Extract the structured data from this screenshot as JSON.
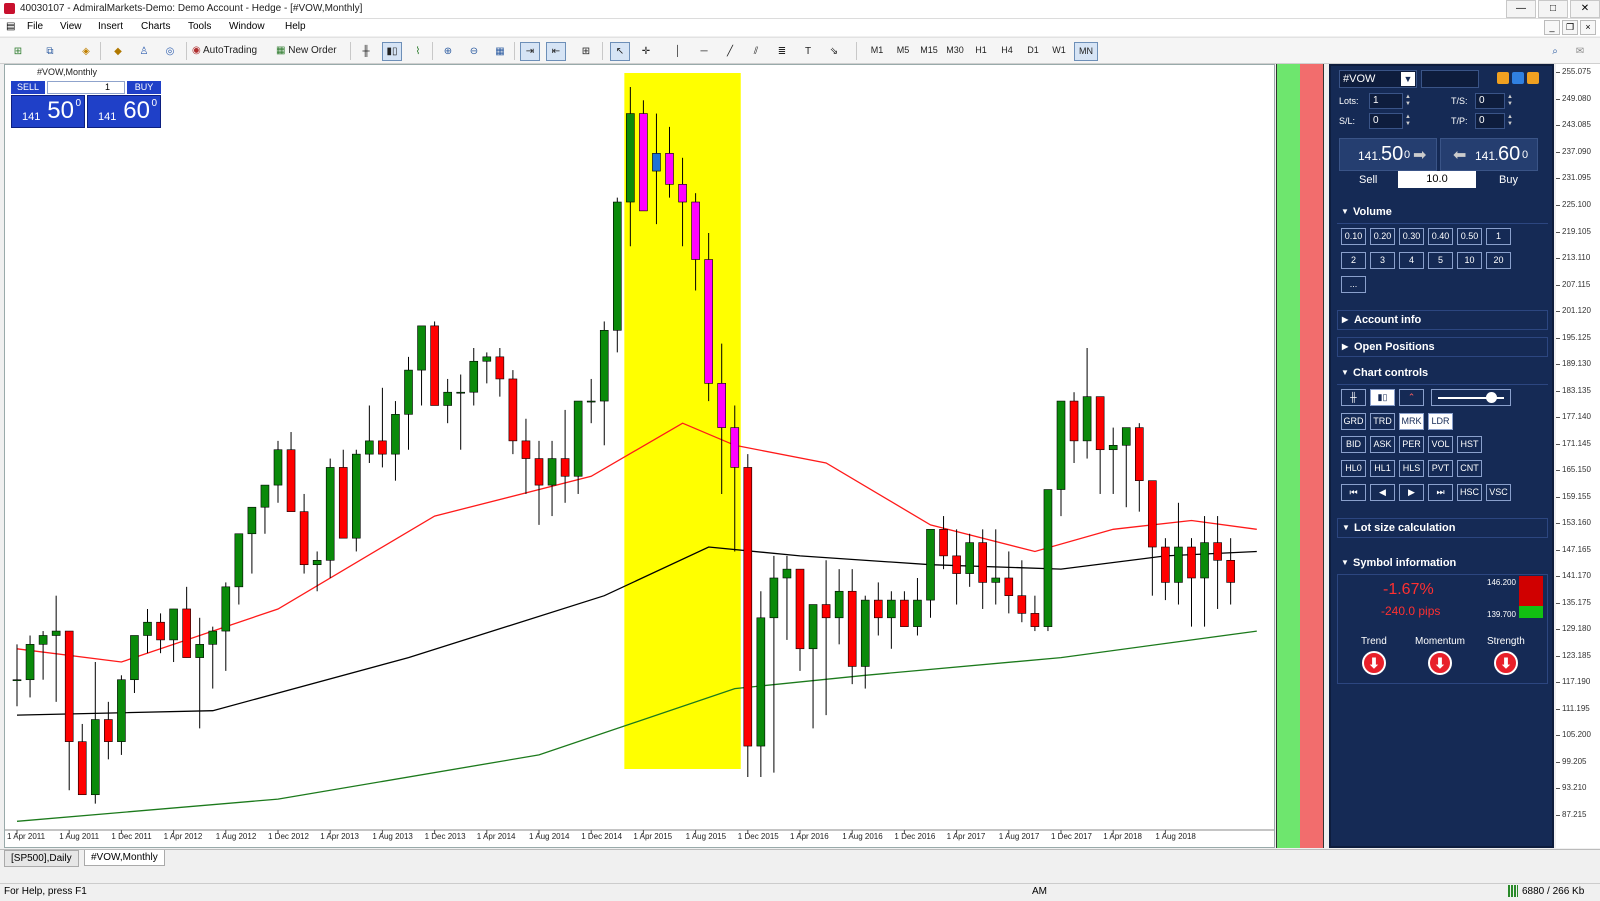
{
  "window": {
    "title": "40030107 - AdmiralMarkets-Demo: Demo Account - Hedge - [#VOW,Monthly]",
    "buttons": [
      "—",
      "□",
      "✕"
    ]
  },
  "menu": [
    "File",
    "View",
    "Insert",
    "Charts",
    "Tools",
    "Window",
    "Help"
  ],
  "mdi_buttons": [
    "_",
    "❐",
    "×"
  ],
  "toolbar": {
    "autotrading": "AutoTrading",
    "new_order": "New Order",
    "timeframes": [
      "M1",
      "M5",
      "M15",
      "M30",
      "H1",
      "H4",
      "D1",
      "W1",
      "MN"
    ],
    "active_timeframe": "MN"
  },
  "chart_title": "#VOW,Monthly",
  "one_click": {
    "sell_label": "SELL",
    "buy_label": "BUY",
    "lot": "1",
    "sell_small": "141",
    "sell_big": "50",
    "sell_sup": "0",
    "buy_small": "141",
    "buy_big": "60",
    "buy_sup": "0"
  },
  "panel": {
    "symbol": "#VOW",
    "lots_label": "Lots:",
    "lots_value": "1",
    "ts_label": "T/S:",
    "ts_value": "0",
    "sl_label": "S/L:",
    "sl_value": "0",
    "tp_label": "T/P:",
    "tp_value": "0",
    "sell_price_small": "141.",
    "sell_price_big": "50",
    "sell_price_sup": "0",
    "buy_price_small": "141.",
    "buy_price_big": "60",
    "buy_price_sup": "0",
    "sell_label": "Sell",
    "buy_label": "Buy",
    "spread": "10.0",
    "sections": {
      "volume": "Volume",
      "account": "Account info",
      "positions": "Open Positions",
      "controls": "Chart controls",
      "lotsize": "Lot size calculation",
      "symbol_info": "Symbol information"
    },
    "volumes": [
      "0.10",
      "0.20",
      "0.30",
      "0.40",
      "0.50",
      "1",
      "2",
      "3",
      "4",
      "5",
      "10",
      "20",
      "..."
    ],
    "control_row1": [
      "GRD",
      "TRD",
      "MRK",
      "LDR"
    ],
    "control_row2": [
      "BID",
      "ASK",
      "PER",
      "VOL",
      "HST"
    ],
    "control_row3": [
      "HL0",
      "HL1",
      "HLS",
      "PVT",
      "CNT"
    ],
    "control_row4": [
      "⏮",
      "◀",
      "▶",
      "⏭",
      "HSC",
      "VSC"
    ],
    "change_pct": "-1.67%",
    "change_pips": "-240.0 pips",
    "range_high": "146.200",
    "range_low": "139.700",
    "trend_label": "Trend",
    "momentum_label": "Momentum",
    "strength_label": "Strength"
  },
  "tabs": [
    "[SP500],Daily",
    "#VOW,Monthly"
  ],
  "active_tab": "#VOW,Monthly",
  "status": {
    "help": "For Help, press F1",
    "mode": "AM",
    "traffic": "6880 / 266 Kb"
  },
  "colors": {
    "bull": "#0a8a0a",
    "bear": "#ff0000",
    "fall_highlight": "#ff00ff",
    "blue_candle": "#1e73d6",
    "highlight_zone": "#ffff00",
    "ma_fast": "#ff1a1a",
    "ma_mid": "#000000",
    "ma_slow": "#1c7a1c",
    "panel_bg": "#152a55"
  },
  "chart_data": {
    "type": "candlestick",
    "symbol": "#VOW",
    "timeframe": "Monthly",
    "ylim": [
      84.25,
      256.075
    ],
    "y_ticks": [
      "255.075",
      "249.080",
      "243.085",
      "237.090",
      "231.095",
      "225.100",
      "219.105",
      "213.110",
      "207.115",
      "201.120",
      "195.125",
      "189.130",
      "183.135",
      "177.140",
      "171.145",
      "165.150",
      "159.155",
      "153.160",
      "147.165",
      "141.170",
      "135.175",
      "129.180",
      "123.185",
      "117.190",
      "111.195",
      "105.200",
      "99.205",
      "93.210",
      "87.215"
    ],
    "x_labels": [
      "1 Apr 2011",
      "1 Aug 2011",
      "1 Dec 2011",
      "1 Apr 2012",
      "1 Aug 2012",
      "1 Dec 2012",
      "1 Apr 2013",
      "1 Aug 2013",
      "1 Dec 2013",
      "1 Apr 2014",
      "1 Aug 2014",
      "1 Dec 2014",
      "1 Apr 2015",
      "1 Aug 2015",
      "1 Dec 2015",
      "1 Apr 2016",
      "1 Aug 2016",
      "1 Dec 2016",
      "1 Apr 2017",
      "1 Aug 2017",
      "1 Dec 2017",
      "1 Apr 2018",
      "1 Aug 2018"
    ],
    "first_bar": "2011-04",
    "ohlc": [
      [
        118,
        126,
        112,
        118
      ],
      [
        118,
        128,
        114,
        126
      ],
      [
        126,
        129,
        118,
        128
      ],
      [
        128,
        137,
        113,
        129
      ],
      [
        129,
        129,
        93,
        104
      ],
      [
        104,
        108,
        92,
        92
      ],
      [
        92,
        122,
        90,
        109
      ],
      [
        109,
        113,
        100,
        104
      ],
      [
        104,
        119,
        101,
        118
      ],
      [
        118,
        128,
        115,
        128
      ],
      [
        128,
        134,
        124,
        131
      ],
      [
        131,
        133,
        124,
        127
      ],
      [
        127,
        134,
        122,
        134
      ],
      [
        134,
        139,
        123,
        123
      ],
      [
        123,
        132,
        107,
        126
      ],
      [
        126,
        130,
        116,
        129
      ],
      [
        129,
        140,
        120,
        139
      ],
      [
        139,
        151,
        135,
        151
      ],
      [
        151,
        157,
        142,
        157
      ],
      [
        157,
        162,
        151,
        162
      ],
      [
        162,
        172,
        158,
        170
      ],
      [
        170,
        174,
        160,
        156
      ],
      [
        156,
        160,
        142,
        144
      ],
      [
        144,
        147,
        138,
        145
      ],
      [
        145,
        168,
        141,
        166
      ],
      [
        166,
        170,
        155,
        150
      ],
      [
        150,
        170,
        147,
        169
      ],
      [
        169,
        180,
        167,
        172
      ],
      [
        172,
        184,
        166,
        169
      ],
      [
        169,
        181,
        163,
        178
      ],
      [
        178,
        191,
        170,
        188
      ],
      [
        188,
        197,
        180,
        198
      ],
      [
        198,
        199,
        183,
        180
      ],
      [
        180,
        186,
        176,
        183
      ],
      [
        183,
        187,
        170,
        183
      ],
      [
        183,
        193,
        180,
        190
      ],
      [
        190,
        192,
        185,
        191
      ],
      [
        191,
        193,
        182,
        186
      ],
      [
        186,
        188,
        169,
        172
      ],
      [
        172,
        177,
        160,
        168
      ],
      [
        168,
        172,
        153,
        162
      ],
      [
        162,
        172,
        155,
        168
      ],
      [
        168,
        179,
        158,
        164
      ],
      [
        164,
        181,
        160,
        181
      ],
      [
        181,
        186,
        176,
        181
      ],
      [
        181,
        199,
        171,
        197
      ],
      [
        197,
        227,
        192,
        226
      ],
      [
        226,
        252,
        216,
        246
      ],
      [
        246,
        249,
        229,
        224
      ],
      [
        233,
        246,
        221,
        237
      ],
      [
        237,
        243,
        227,
        230
      ],
      [
        230,
        236,
        216,
        226
      ],
      [
        226,
        228,
        206,
        213
      ],
      [
        213,
        219,
        181,
        185
      ],
      [
        185,
        194,
        160,
        175
      ],
      [
        175,
        180,
        147,
        166
      ],
      [
        166,
        169,
        96,
        103
      ],
      [
        103,
        138,
        96,
        132
      ],
      [
        132,
        146,
        97,
        141
      ],
      [
        141,
        146,
        127,
        143
      ],
      [
        143,
        143,
        120,
        125
      ],
      [
        125,
        135,
        107,
        135
      ],
      [
        135,
        145,
        110,
        132
      ],
      [
        132,
        143,
        126,
        138
      ],
      [
        138,
        143,
        117,
        121
      ],
      [
        121,
        137,
        116,
        136
      ],
      [
        136,
        140,
        128,
        132
      ],
      [
        132,
        138,
        125,
        136
      ],
      [
        136,
        138,
        130,
        130
      ],
      [
        130,
        141,
        128,
        136
      ],
      [
        136,
        148,
        132,
        152
      ],
      [
        152,
        155,
        143,
        146
      ],
      [
        146,
        152,
        135,
        142
      ],
      [
        142,
        151,
        139,
        149
      ],
      [
        149,
        152,
        134,
        140
      ],
      [
        140,
        152,
        135,
        141
      ],
      [
        141,
        147,
        133,
        137
      ],
      [
        137,
        145,
        131,
        133
      ],
      [
        133,
        137,
        129,
        130
      ],
      [
        130,
        155,
        129,
        161
      ],
      [
        161,
        177,
        155,
        181
      ],
      [
        181,
        183,
        167,
        172
      ],
      [
        172,
        193,
        168,
        182
      ],
      [
        182,
        178,
        160,
        170
      ],
      [
        170,
        175,
        160,
        171
      ],
      [
        171,
        175,
        157,
        175
      ],
      [
        175,
        176,
        156,
        163
      ],
      [
        163,
        162,
        137,
        148
      ],
      [
        148,
        150,
        136,
        140
      ],
      [
        140,
        158,
        135,
        148
      ],
      [
        148,
        150,
        130,
        141
      ],
      [
        141,
        155,
        130,
        149
      ],
      [
        149,
        155,
        134,
        145
      ],
      [
        145,
        150,
        135,
        140
      ]
    ],
    "series": [
      {
        "type": "line",
        "values": [
          {
            "bar": 0,
            "value": 125
          },
          {
            "bar": 8,
            "value": 122
          },
          {
            "bar": 20,
            "value": 134
          },
          {
            "bar": 32,
            "value": 155
          },
          {
            "bar": 44,
            "value": 164
          },
          {
            "bar": 51,
            "value": 176
          },
          {
            "bar": 55,
            "value": 171
          },
          {
            "bar": 62,
            "value": 167
          },
          {
            "bar": 70,
            "value": 153
          },
          {
            "bar": 78,
            "value": 147
          },
          {
            "bar": 84,
            "value": 152
          },
          {
            "bar": 90,
            "value": 154
          },
          {
            "bar": 95,
            "value": 152
          }
        ]
      },
      {
        "type": "line",
        "values": [
          {
            "bar": 0,
            "value": 110
          },
          {
            "bar": 15,
            "value": 111
          },
          {
            "bar": 30,
            "value": 123
          },
          {
            "bar": 45,
            "value": 137
          },
          {
            "bar": 53,
            "value": 148
          },
          {
            "bar": 60,
            "value": 146
          },
          {
            "bar": 70,
            "value": 144
          },
          {
            "bar": 80,
            "value": 143
          },
          {
            "bar": 88,
            "value": 146
          },
          {
            "bar": 95,
            "value": 147
          }
        ]
      },
      {
        "type": "line",
        "values": [
          {
            "bar": 0,
            "value": 86
          },
          {
            "bar": 20,
            "value": 91
          },
          {
            "bar": 40,
            "value": 101
          },
          {
            "bar": 55,
            "value": 116
          },
          {
            "bar": 65,
            "value": 119
          },
          {
            "bar": 80,
            "value": 123
          },
          {
            "bar": 95,
            "value": 129
          }
        ]
      }
    ],
    "highlight_bars": [
      47,
      55
    ],
    "highlight_color": "#ffff00"
  }
}
